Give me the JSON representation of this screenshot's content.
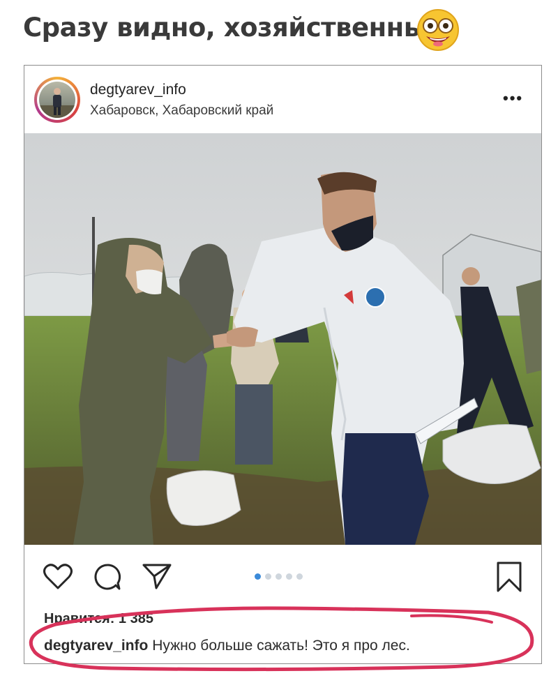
{
  "headline": {
    "text": "Сразу видно, хозяйственный"
  },
  "post": {
    "username": "degtyarev_info",
    "location": "Хабаровск, Хабаровский край",
    "more_label": "•••",
    "likes_text": "Нравится: 1 385",
    "caption_user": "degtyarev_info",
    "caption_text": " Нужно больше сажать! Это я про лес.",
    "carousel": {
      "count": 5,
      "active_index": 0
    }
  },
  "icons": {
    "emoji": "grinning-flushed-emoji-icon",
    "like": "heart-icon",
    "comment": "comment-bubble-icon",
    "share": "paper-plane-icon",
    "save": "bookmark-icon",
    "options": "more-options-icon"
  },
  "colors": {
    "highlight": "#d8325a",
    "active_dot": "#3b8ad9",
    "story_ring": "#d9433f"
  }
}
